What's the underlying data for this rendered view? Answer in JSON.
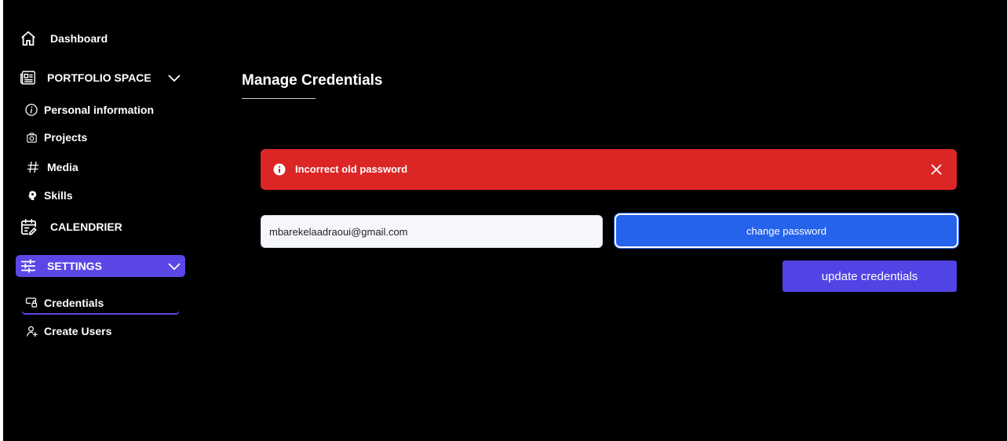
{
  "sidebar": {
    "dashboard": {
      "label": "Dashboard",
      "icon": "home-icon"
    },
    "portfolio": {
      "label": "PORTFOLIO SPACE",
      "icon": "newspaper-icon",
      "items": [
        {
          "label": "Personal information",
          "icon": "info-circle-icon"
        },
        {
          "label": "Projects",
          "icon": "camera-icon"
        },
        {
          "label": "Media",
          "icon": "hashtag-icon"
        },
        {
          "label": "Skills",
          "icon": "brain-icon"
        }
      ]
    },
    "calendar": {
      "label": "CALENDRIER",
      "icon": "calendar-edit-icon"
    },
    "settings": {
      "label": "SETTINGS",
      "icon": "sliders-icon",
      "items": [
        {
          "label": "Credentials",
          "icon": "key-icon",
          "active": true
        },
        {
          "label": "Create Users",
          "icon": "user-plus-icon"
        }
      ]
    }
  },
  "main": {
    "title": "Manage Credentials",
    "alert": {
      "message": "Incorrect old password",
      "type": "error"
    },
    "form": {
      "email_value": "mbarekelaadraoui@gmail.com",
      "change_password_label": "change password",
      "update_label": "update credentials"
    }
  },
  "colors": {
    "background": "#000000",
    "accent": "#5b47e5",
    "error": "#dc2626",
    "primary_button": "#2563eb"
  }
}
